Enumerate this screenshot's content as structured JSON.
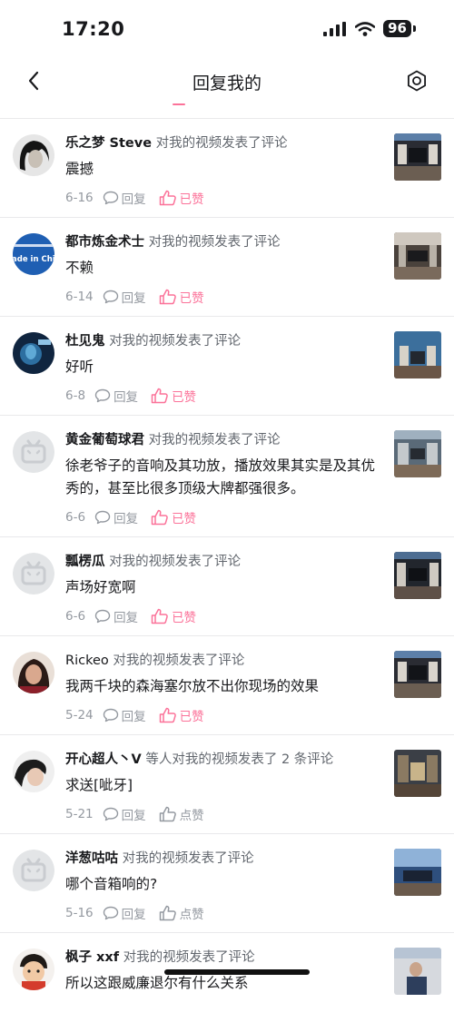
{
  "status": {
    "time": "17:20",
    "battery": "96"
  },
  "header": {
    "title": "回复我的"
  },
  "comments": [
    {
      "user": "乐之梦 Steve",
      "action": "对我的视频发表了评论",
      "text": "震撼",
      "date": "6-16",
      "reply": "回复",
      "like": "已赞",
      "liked": true
    },
    {
      "user": "都市炼金术士",
      "action": "对我的视频发表了评论",
      "text": "不赖",
      "date": "6-14",
      "reply": "回复",
      "like": "已赞",
      "liked": true,
      "avatar_text": "ade in Chi"
    },
    {
      "user": "杜见鬼",
      "action": "对我的视频发表了评论",
      "text": "好听",
      "date": "6-8",
      "reply": "回复",
      "like": "已赞",
      "liked": true
    },
    {
      "user": "黄金葡萄球君",
      "action": "对我的视频发表了评论",
      "text": "徐老爷子的音响及其功放，播放效果其实是及其优秀的，甚至比很多顶级大牌都强很多。",
      "date": "6-6",
      "reply": "回复",
      "like": "已赞",
      "liked": true
    },
    {
      "user": "瓢楞瓜",
      "action": "对我的视频发表了评论",
      "text": "声场好宽啊",
      "date": "6-6",
      "reply": "回复",
      "like": "已赞",
      "liked": true
    },
    {
      "user": "Rickeo",
      "action": "对我的视频发表了评论",
      "text": "我两千块的森海塞尔放不出你现场的效果",
      "date": "5-24",
      "reply": "回复",
      "like": "已赞",
      "liked": true
    },
    {
      "user": "开心超人丶V",
      "action": "等人对我的视频发表了 2 条评论",
      "text": "求送[呲牙]",
      "date": "5-21",
      "reply": "回复",
      "like": "点赞",
      "liked": false
    },
    {
      "user": "洋葱咕咕",
      "action": "对我的视频发表了评论",
      "text": "哪个音箱响的?",
      "date": "5-16",
      "reply": "回复",
      "like": "点赞",
      "liked": false
    },
    {
      "user": "枫子 xxf",
      "action": "对我的视频发表了评论",
      "text": "所以这跟威廉退尔有什么关系",
      "date": "",
      "reply": "",
      "like": "",
      "liked": false
    }
  ],
  "colors": {
    "accent": "#fb7299",
    "muted": "#9499a0",
    "divider": "#e9e9eb"
  }
}
